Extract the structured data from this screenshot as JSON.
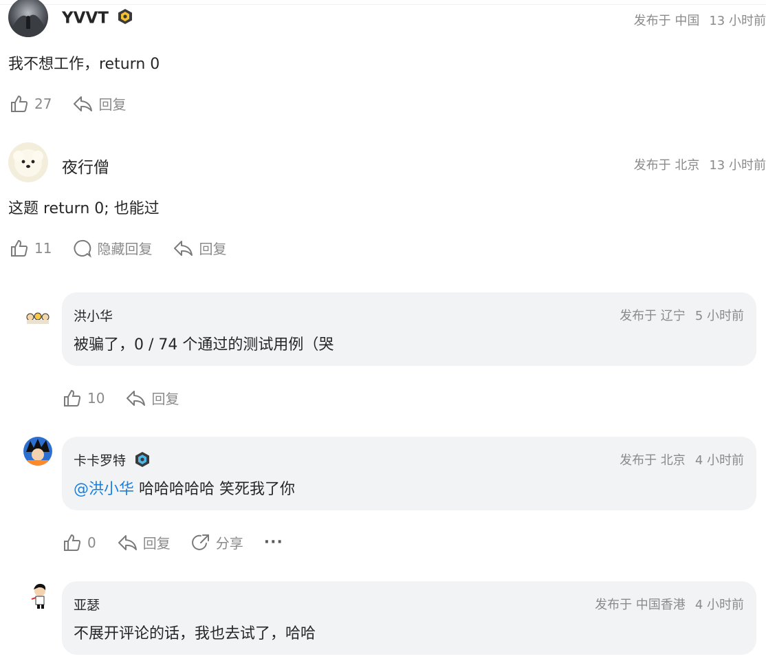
{
  "comments": [
    {
      "username": "YVVT",
      "location": "发布于 中国",
      "time": "13 小时前",
      "text": "我不想工作，return 0",
      "likes": "27",
      "reply_label": "回复"
    },
    {
      "username": "夜行僧",
      "location": "发布于 北京",
      "time": "13 小时前",
      "text": "这题 return 0; 也能过",
      "likes": "11",
      "hide_replies_label": "隐藏回复",
      "reply_label": "回复"
    }
  ],
  "replies": [
    {
      "username": "洪小华",
      "location": "发布于 辽宁",
      "time": "5 小时前",
      "text": "被骗了，0 / 74 个通过的测试用例（哭",
      "likes": "10",
      "reply_label": "回复"
    },
    {
      "username": "卡卡罗特",
      "location": "发布于 北京",
      "time": "4 小时前",
      "mention": "@洪小华",
      "text": " 哈哈哈哈哈 笑死我了你",
      "likes": "0",
      "reply_label": "回复",
      "share_label": "分享",
      "more_label": "···"
    },
    {
      "username": "亚瑟",
      "location": "发布于 中国香港",
      "time": "4 小时前",
      "text": "不展开评论的话，我也去试了，哈哈"
    }
  ],
  "colors": {
    "mention": "#1a7fe0",
    "bubble_bg": "#f2f3f5",
    "muted_text": "#8a8a8a",
    "main_text": "#262626"
  }
}
